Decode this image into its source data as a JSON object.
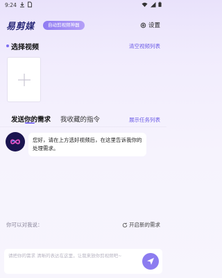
{
  "status_bar": {
    "time": "9:24"
  },
  "header": {
    "app_name": "易剪媒",
    "badge": "自动剪视频神器",
    "settings_label": "设置"
  },
  "select_video": {
    "title": "选择视频",
    "clear_link": "清空视频列表"
  },
  "tabs": {
    "active": "发送你的需求",
    "inactive": "我收藏的指令",
    "show_tasks": "展示任务列表"
  },
  "chat": {
    "message": "您好，请在上方选好视频后，在这里告诉我你的处理需求。"
  },
  "footer": {
    "hint_label": "你可以对我说：",
    "new_request": "开启新的需求"
  },
  "composer": {
    "placeholder": "请把你的需求 清晰的表达在这里，让我来放你剪视频吧~"
  },
  "colors": {
    "accent": "#7d6df1",
    "logo": "#2b2b7a",
    "send_button": "#8c7cf0"
  }
}
